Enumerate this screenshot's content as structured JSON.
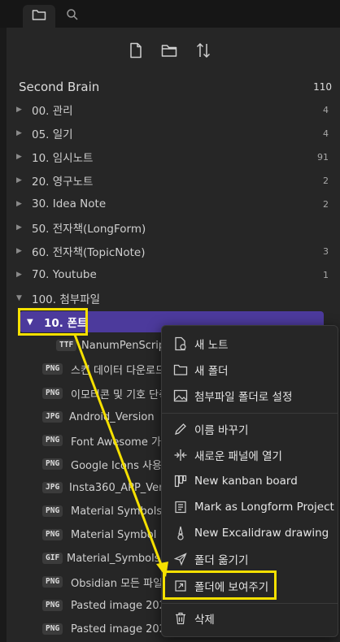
{
  "vault": {
    "name": "Second Brain",
    "count": "110"
  },
  "folders": [
    {
      "label": "00. 관리",
      "count": "4"
    },
    {
      "label": "05. 일기",
      "count": "4"
    },
    {
      "label": "10. 임시노트",
      "count": "91"
    },
    {
      "label": "20. 영구노트",
      "count": "2"
    },
    {
      "label": "30. Idea Note",
      "count": "2"
    },
    {
      "label": "50. 전자책(LongForm)",
      "count": ""
    },
    {
      "label": "60. 전자책(TopicNote)",
      "count": "3"
    },
    {
      "label": "70. Youtube",
      "count": "1"
    },
    {
      "label": "100. 첨부파일",
      "count": ""
    }
  ],
  "active_folder": {
    "label": "10. 폰트"
  },
  "files": [
    {
      "badge": "TTF",
      "name": "NanumPenScrip"
    },
    {
      "badge": "PNG",
      "name": "스킨 데이터 다운로드"
    },
    {
      "badge": "PNG",
      "name": "이모티콘 및 기호 단축"
    },
    {
      "badge": "JPG",
      "name": "Android_Version"
    },
    {
      "badge": "PNG",
      "name": "Font Awesome 가"
    },
    {
      "badge": "PNG",
      "name": "Google Icons 사용"
    },
    {
      "badge": "JPG",
      "name": "Insta360_APP_Ver"
    },
    {
      "badge": "PNG",
      "name": "Material Symbols"
    },
    {
      "badge": "PNG",
      "name": "Material Symbol"
    },
    {
      "badge": "GIF",
      "name": "Material_Symbols"
    },
    {
      "badge": "PNG",
      "name": "Obsidian 모든 파일"
    },
    {
      "badge": "PNG",
      "name": "Pasted image 202"
    },
    {
      "badge": "PNG",
      "name": "Pasted image 202"
    }
  ],
  "context_menu": {
    "items": [
      {
        "label": "새 노트",
        "icon": "new-note-icon"
      },
      {
        "label": "새 폴더",
        "icon": "new-folder-icon"
      },
      {
        "label": "첨부파일 폴더로 설정",
        "icon": "image-icon"
      },
      {
        "label": "이름 바꾸기",
        "icon": "pencil-icon"
      },
      {
        "label": "새로운 패널에 열기",
        "icon": "split-pane-icon"
      },
      {
        "label": "New kanban board",
        "icon": "kanban-icon"
      },
      {
        "label": "Mark as Longform Project",
        "icon": "book-icon"
      },
      {
        "label": "New Excalidraw drawing",
        "icon": "excalidraw-icon"
      },
      {
        "label": "폴더 옮기기",
        "icon": "send-icon"
      },
      {
        "label": "폴더에 보여주기",
        "icon": "external-icon"
      },
      {
        "label": "삭제",
        "icon": "trash-icon"
      }
    ]
  },
  "colors": {
    "accent": "#4c3a9c",
    "highlight": "#f5e000",
    "background": "#262626"
  }
}
